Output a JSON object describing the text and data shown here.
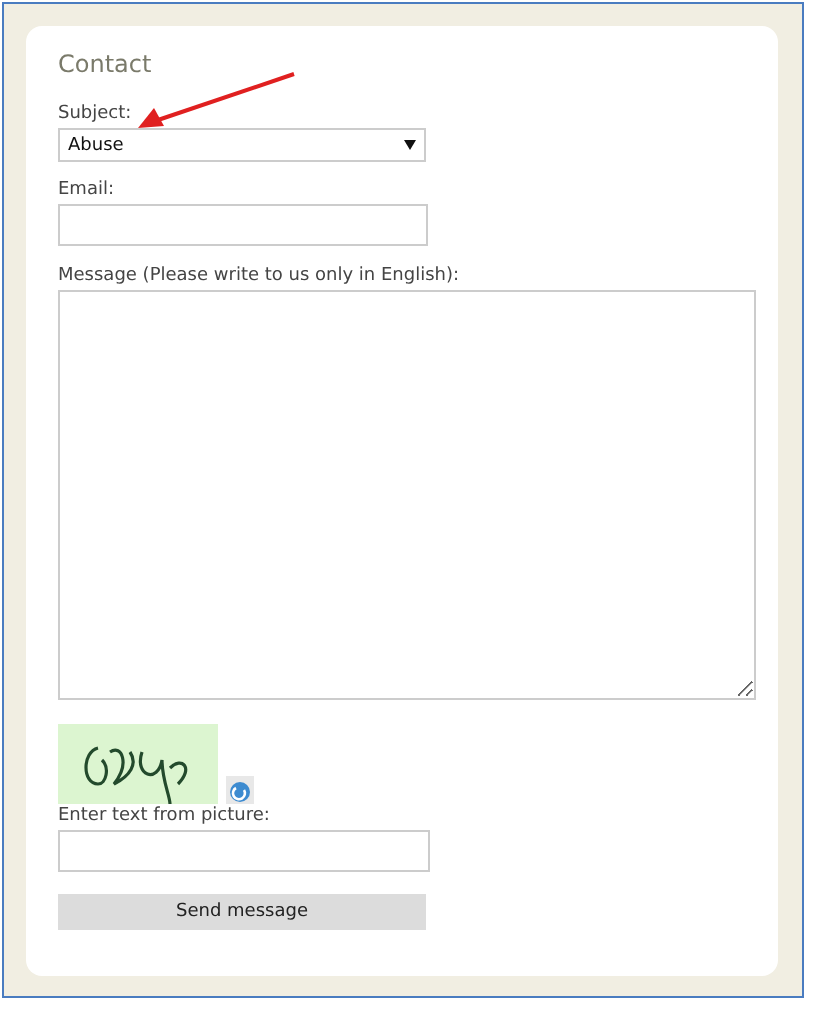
{
  "form": {
    "title": "Contact",
    "subject": {
      "label": "Subject:",
      "value": "Abuse"
    },
    "email": {
      "label": "Email:"
    },
    "message": {
      "label": "Message (Please write to us only in English):"
    },
    "captcha": {
      "kind": "picture",
      "label": "Enter text from picture:"
    },
    "submit": "Send message"
  }
}
